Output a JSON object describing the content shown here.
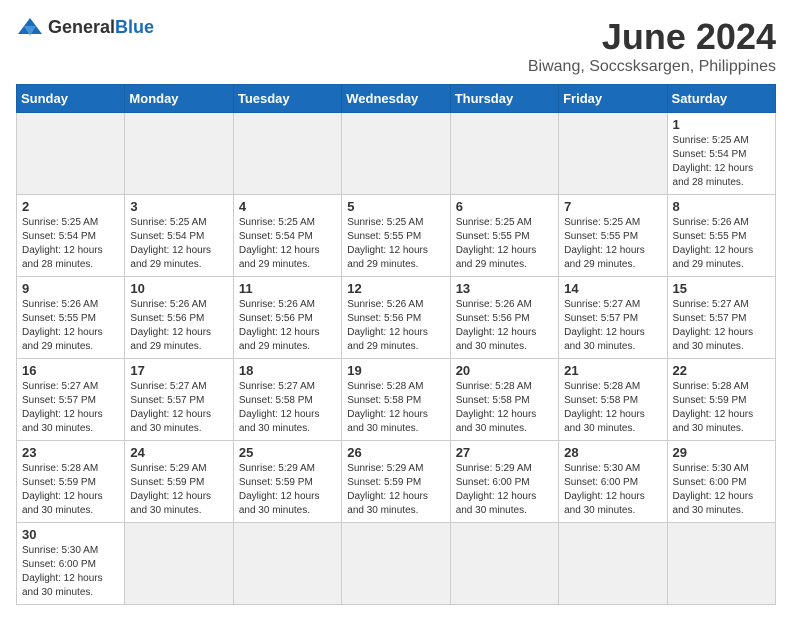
{
  "logo": {
    "general": "General",
    "blue": "Blue"
  },
  "title": "June 2024",
  "location": "Biwang, Soccsksargen, Philippines",
  "days_header": [
    "Sunday",
    "Monday",
    "Tuesday",
    "Wednesday",
    "Thursday",
    "Friday",
    "Saturday"
  ],
  "weeks": [
    [
      {
        "day": "",
        "info": ""
      },
      {
        "day": "",
        "info": ""
      },
      {
        "day": "",
        "info": ""
      },
      {
        "day": "",
        "info": ""
      },
      {
        "day": "",
        "info": ""
      },
      {
        "day": "",
        "info": ""
      },
      {
        "day": "1",
        "info": "Sunrise: 5:25 AM\nSunset: 5:54 PM\nDaylight: 12 hours and 28 minutes."
      }
    ],
    [
      {
        "day": "2",
        "info": "Sunrise: 5:25 AM\nSunset: 5:54 PM\nDaylight: 12 hours and 28 minutes."
      },
      {
        "day": "3",
        "info": "Sunrise: 5:25 AM\nSunset: 5:54 PM\nDaylight: 12 hours and 29 minutes."
      },
      {
        "day": "4",
        "info": "Sunrise: 5:25 AM\nSunset: 5:54 PM\nDaylight: 12 hours and 29 minutes."
      },
      {
        "day": "5",
        "info": "Sunrise: 5:25 AM\nSunset: 5:55 PM\nDaylight: 12 hours and 29 minutes."
      },
      {
        "day": "6",
        "info": "Sunrise: 5:25 AM\nSunset: 5:55 PM\nDaylight: 12 hours and 29 minutes."
      },
      {
        "day": "7",
        "info": "Sunrise: 5:25 AM\nSunset: 5:55 PM\nDaylight: 12 hours and 29 minutes."
      },
      {
        "day": "8",
        "info": "Sunrise: 5:26 AM\nSunset: 5:55 PM\nDaylight: 12 hours and 29 minutes."
      }
    ],
    [
      {
        "day": "9",
        "info": "Sunrise: 5:26 AM\nSunset: 5:55 PM\nDaylight: 12 hours and 29 minutes."
      },
      {
        "day": "10",
        "info": "Sunrise: 5:26 AM\nSunset: 5:56 PM\nDaylight: 12 hours and 29 minutes."
      },
      {
        "day": "11",
        "info": "Sunrise: 5:26 AM\nSunset: 5:56 PM\nDaylight: 12 hours and 29 minutes."
      },
      {
        "day": "12",
        "info": "Sunrise: 5:26 AM\nSunset: 5:56 PM\nDaylight: 12 hours and 29 minutes."
      },
      {
        "day": "13",
        "info": "Sunrise: 5:26 AM\nSunset: 5:56 PM\nDaylight: 12 hours and 30 minutes."
      },
      {
        "day": "14",
        "info": "Sunrise: 5:27 AM\nSunset: 5:57 PM\nDaylight: 12 hours and 30 minutes."
      },
      {
        "day": "15",
        "info": "Sunrise: 5:27 AM\nSunset: 5:57 PM\nDaylight: 12 hours and 30 minutes."
      }
    ],
    [
      {
        "day": "16",
        "info": "Sunrise: 5:27 AM\nSunset: 5:57 PM\nDaylight: 12 hours and 30 minutes."
      },
      {
        "day": "17",
        "info": "Sunrise: 5:27 AM\nSunset: 5:57 PM\nDaylight: 12 hours and 30 minutes."
      },
      {
        "day": "18",
        "info": "Sunrise: 5:27 AM\nSunset: 5:58 PM\nDaylight: 12 hours and 30 minutes."
      },
      {
        "day": "19",
        "info": "Sunrise: 5:28 AM\nSunset: 5:58 PM\nDaylight: 12 hours and 30 minutes."
      },
      {
        "day": "20",
        "info": "Sunrise: 5:28 AM\nSunset: 5:58 PM\nDaylight: 12 hours and 30 minutes."
      },
      {
        "day": "21",
        "info": "Sunrise: 5:28 AM\nSunset: 5:58 PM\nDaylight: 12 hours and 30 minutes."
      },
      {
        "day": "22",
        "info": "Sunrise: 5:28 AM\nSunset: 5:59 PM\nDaylight: 12 hours and 30 minutes."
      }
    ],
    [
      {
        "day": "23",
        "info": "Sunrise: 5:28 AM\nSunset: 5:59 PM\nDaylight: 12 hours and 30 minutes."
      },
      {
        "day": "24",
        "info": "Sunrise: 5:29 AM\nSunset: 5:59 PM\nDaylight: 12 hours and 30 minutes."
      },
      {
        "day": "25",
        "info": "Sunrise: 5:29 AM\nSunset: 5:59 PM\nDaylight: 12 hours and 30 minutes."
      },
      {
        "day": "26",
        "info": "Sunrise: 5:29 AM\nSunset: 5:59 PM\nDaylight: 12 hours and 30 minutes."
      },
      {
        "day": "27",
        "info": "Sunrise: 5:29 AM\nSunset: 6:00 PM\nDaylight: 12 hours and 30 minutes."
      },
      {
        "day": "28",
        "info": "Sunrise: 5:30 AM\nSunset: 6:00 PM\nDaylight: 12 hours and 30 minutes."
      },
      {
        "day": "29",
        "info": "Sunrise: 5:30 AM\nSunset: 6:00 PM\nDaylight: 12 hours and 30 minutes."
      }
    ],
    [
      {
        "day": "30",
        "info": "Sunrise: 5:30 AM\nSunset: 6:00 PM\nDaylight: 12 hours and 30 minutes."
      },
      {
        "day": "",
        "info": ""
      },
      {
        "day": "",
        "info": ""
      },
      {
        "day": "",
        "info": ""
      },
      {
        "day": "",
        "info": ""
      },
      {
        "day": "",
        "info": ""
      },
      {
        "day": "",
        "info": ""
      }
    ]
  ]
}
